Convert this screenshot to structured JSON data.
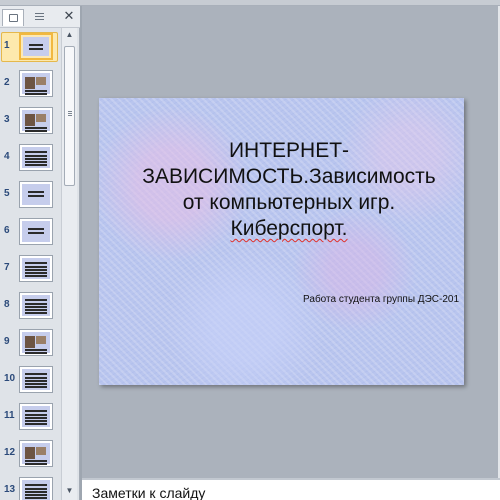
{
  "slides_pane": {
    "close_glyph": "✕",
    "thumbnails": [
      {
        "num": "1",
        "selected": true,
        "style": "title"
      },
      {
        "num": "2",
        "selected": false,
        "style": "photo"
      },
      {
        "num": "3",
        "selected": false,
        "style": "photo"
      },
      {
        "num": "4",
        "selected": false,
        "style": "text"
      },
      {
        "num": "5",
        "selected": false,
        "style": "title"
      },
      {
        "num": "6",
        "selected": false,
        "style": "title"
      },
      {
        "num": "7",
        "selected": false,
        "style": "text"
      },
      {
        "num": "8",
        "selected": false,
        "style": "text"
      },
      {
        "num": "9",
        "selected": false,
        "style": "photo"
      },
      {
        "num": "10",
        "selected": false,
        "style": "text"
      },
      {
        "num": "11",
        "selected": false,
        "style": "text"
      },
      {
        "num": "12",
        "selected": false,
        "style": "photo"
      },
      {
        "num": "13",
        "selected": false,
        "style": "text"
      }
    ]
  },
  "slide": {
    "title_line1": "ИНТЕРНЕТ-",
    "title_line2": "ЗАВИСИМОСТЬ.Зависимость",
    "title_line3": "от компьютерных игр.",
    "title_line4": "Киберспорт.",
    "subtitle": "Работа студента группы ДЭС-201"
  },
  "notes": {
    "placeholder": "Заметки к слайду"
  },
  "colors": {
    "selection": "#fde9ad",
    "slide_bg": "#b9c5ee",
    "spellcheck": "#e0302a"
  }
}
